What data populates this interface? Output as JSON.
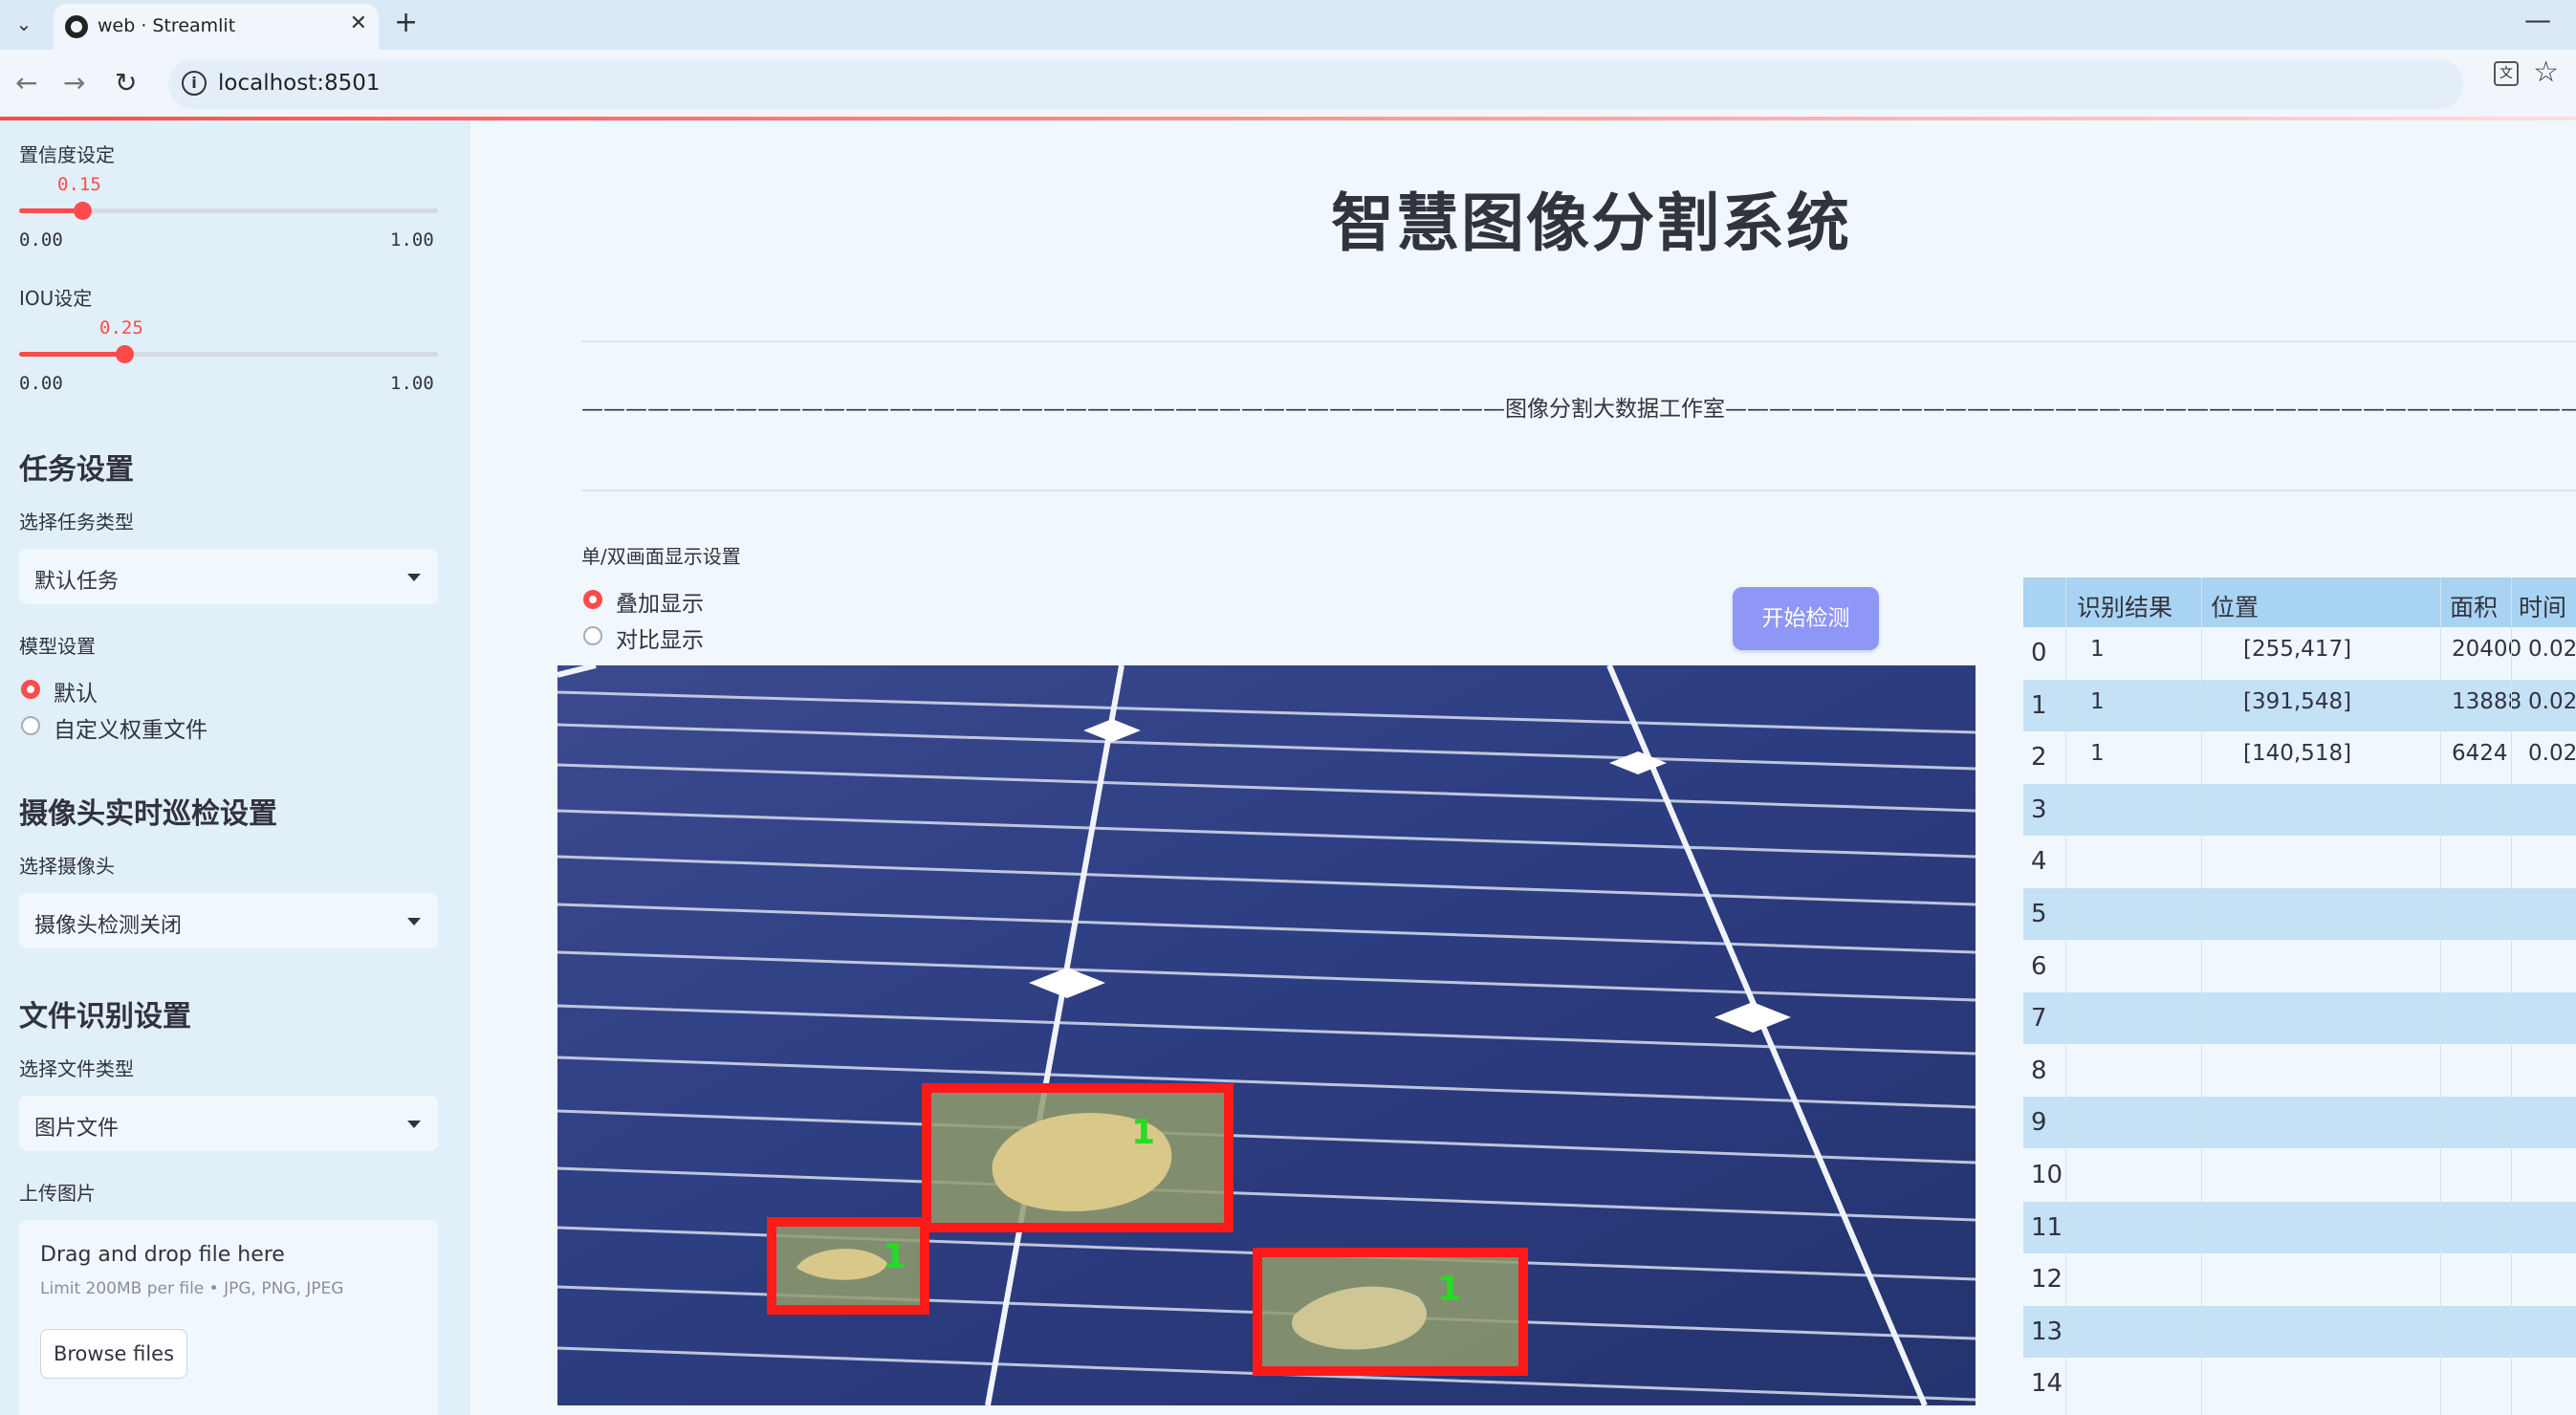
{
  "browser": {
    "tab_title": "web · Streamlit",
    "url": "localhost:8501"
  },
  "sidebar": {
    "confidence": {
      "label": "置信度设定",
      "value": "0.15",
      "min": "0.00",
      "max": "1.00",
      "level": 0.15
    },
    "iou": {
      "label": "IOU设定",
      "value": "0.25",
      "min": "0.00",
      "max": "1.00",
      "level": 0.25
    },
    "task": {
      "heading": "任务设置",
      "label": "选择任务类型",
      "selected": "默认任务"
    },
    "model": {
      "label": "模型设置",
      "options": [
        "默认",
        "自定义权重文件"
      ],
      "selected_index": 0
    },
    "camera": {
      "heading": "摄像头实时巡检设置",
      "label": "选择摄像头",
      "selected": "摄像头检测关闭"
    },
    "file": {
      "heading": "文件识别设置",
      "label": "选择文件类型",
      "selected": "图片文件"
    },
    "upload": {
      "label": "上传图片",
      "drop_title": "Drag and drop file here",
      "limit": "Limit 200MB per file • JPG, PNG, JPEG",
      "browse": "Browse files"
    }
  },
  "main": {
    "title": "智慧图像分割系统",
    "studio": "——————————————————————————————————————————图像分割大数据工作室——————————————————————————————————————————",
    "display": {
      "label": "单/双画面显示设置",
      "options": [
        "叠加显示",
        "对比显示"
      ],
      "selected_index": 0
    },
    "start_button": "开始检测",
    "detections": [
      {
        "label": "1"
      },
      {
        "label": "1"
      },
      {
        "label": "1"
      }
    ]
  },
  "table": {
    "headers": [
      "识别结果",
      "位置",
      "面积",
      "时间"
    ],
    "rows": [
      {
        "idx": "0",
        "result": "1",
        "position": "[255,417]",
        "area": "20400",
        "time": "0.02"
      },
      {
        "idx": "1",
        "result": "1",
        "position": "[391,548]",
        "area": "13888",
        "time": "0.02"
      },
      {
        "idx": "2",
        "result": "1",
        "position": "[140,518]",
        "area": "6424",
        "time": "0.02"
      },
      {
        "idx": "3"
      },
      {
        "idx": "4"
      },
      {
        "idx": "5"
      },
      {
        "idx": "6"
      },
      {
        "idx": "7"
      },
      {
        "idx": "8"
      },
      {
        "idx": "9"
      },
      {
        "idx": "10"
      },
      {
        "idx": "11"
      },
      {
        "idx": "12"
      },
      {
        "idx": "13"
      },
      {
        "idx": "14"
      }
    ]
  },
  "colors": {
    "accent": "#ff4b4b",
    "button": "#8e97f5",
    "box": "#ff1a1a",
    "box_label": "#22dd22"
  }
}
